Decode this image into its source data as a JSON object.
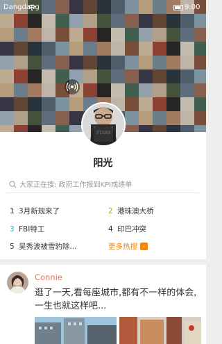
{
  "status_bar": {
    "carrier": "Dangdang",
    "time": "9:00"
  },
  "profile": {
    "name": "阳光"
  },
  "search": {
    "placeholder": "大家正在搜: 政府工作报到KPI成绩单"
  },
  "hot_searches": [
    {
      "rank": "1",
      "label": "3月新规来了",
      "rank_color": "#333333"
    },
    {
      "rank": "2",
      "label": "港珠澳大桥",
      "rank_color": "#7cc23a"
    },
    {
      "rank": "3",
      "label": "FBI特工",
      "rank_color": "#3cb0c8"
    },
    {
      "rank": "4",
      "label": "印巴冲突",
      "rank_color": "#333333"
    },
    {
      "rank": "5",
      "label": "吴秀波被雪豹除...",
      "rank_color": "#333333"
    }
  ],
  "more_hot": {
    "label": "更多热搜",
    "arrow": "›"
  },
  "feed": {
    "author": "Connie",
    "text": "逛了一天,看每座城市,都有不一样的体会,一生也就这样吧..."
  },
  "theme": {
    "accent": "#ff8200",
    "author_color": "#eb7350"
  }
}
